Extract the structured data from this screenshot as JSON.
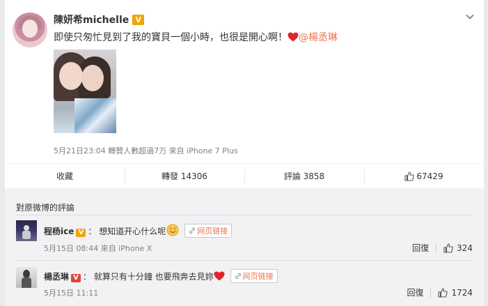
{
  "post": {
    "username": "陳妍希michelle",
    "verified_badge": "V",
    "content": "即使只匆忙見到了我的寶貝一個小時，也很是開心啊！",
    "mention": "@楊丞琳",
    "meta": "5月21日23:04 轉贊人數超過7万 來自 iPhone 7 Plus"
  },
  "actions": {
    "favorite_label": "收藏",
    "repost_label": "轉發 14306",
    "comment_label": "評論 3858",
    "like_count": "67429"
  },
  "comments": {
    "section_title": "對原微博的評論",
    "items": [
      {
        "username": "程杨ice",
        "badge": "V",
        "text": "想知道开心什么呢",
        "link_label": "网页链接",
        "meta": "5月15日 08:44 來自 iPhone X",
        "reply_label": "回復",
        "likes": "324"
      },
      {
        "username": "楊丞琳",
        "badge": "V",
        "text": "就算只有十分鐘 也要飛奔去見妳",
        "link_label": "网页链接",
        "meta": "5月15日 11:11",
        "reply_label": "回復",
        "likes": "1724"
      }
    ]
  },
  "colors": {
    "accent": "#eb7350",
    "badge_gold": "#f0a30a",
    "heart": "#e0242c"
  },
  "icons": [
    "chevron-down-icon",
    "heart-icon",
    "thumbs-up-icon",
    "link-icon",
    "smile-emoji-icon",
    "verified-badge-icon"
  ]
}
